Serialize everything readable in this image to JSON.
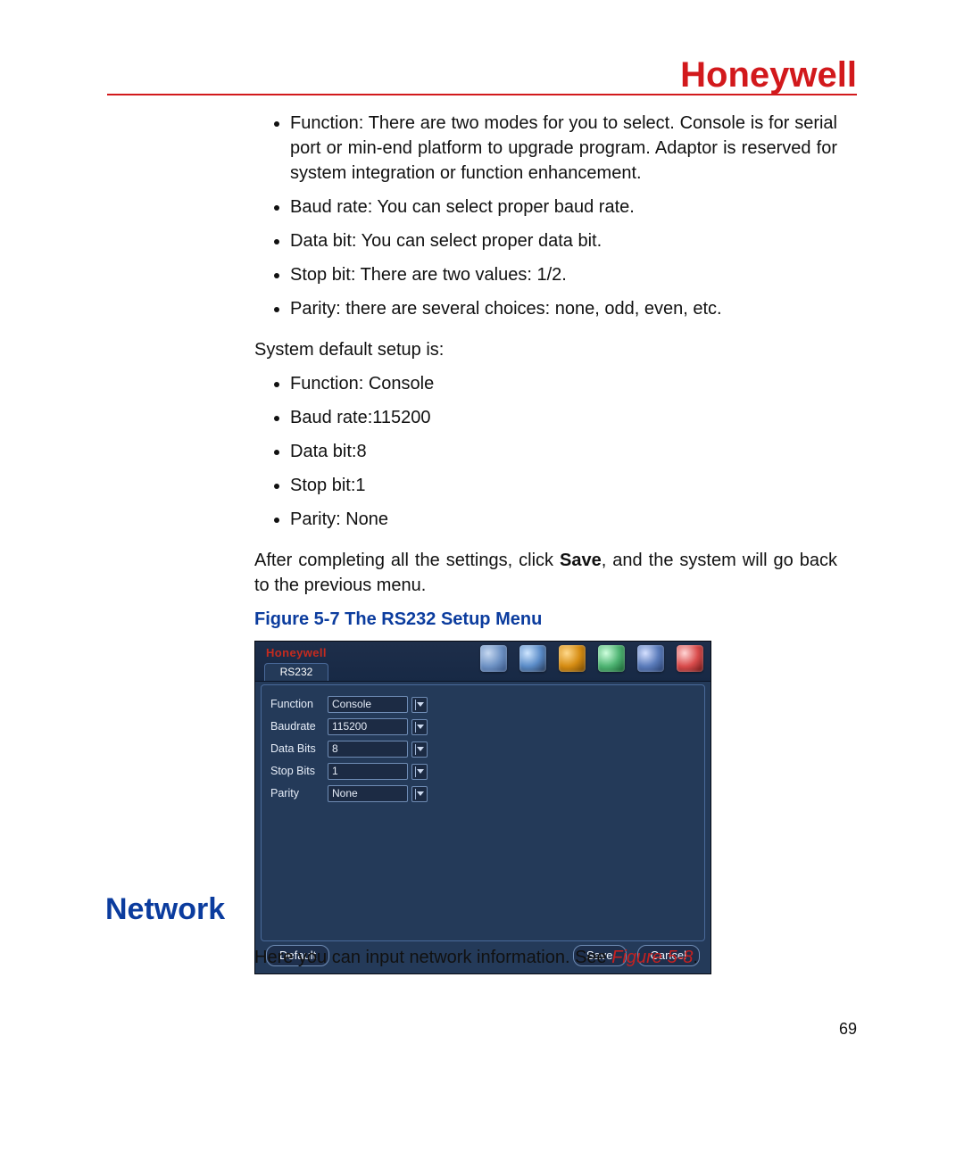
{
  "brand": "Honeywell",
  "bullets1": [
    "Function: There are two modes for you to select. Console is for serial port or min-end platform to upgrade program. Adaptor is reserved for system integration or function enhancement.",
    "Baud rate: You can select proper baud rate.",
    "Data bit: You can select proper data bit.",
    "Stop bit: There are two values: 1/2.",
    "Parity: there are several choices: none, odd, even, etc."
  ],
  "defaults_intro": "System default setup is:",
  "bullets2": [
    "Function: Console",
    "Baud rate:115200",
    "Data bit:8",
    "Stop bit:1",
    "Parity: None"
  ],
  "after_settings_pre": "After completing all the settings, click ",
  "after_settings_bold": "Save",
  "after_settings_post": ", and the system will go back to the previous menu.",
  "figure_caption": "Figure 5-7 The RS232 Setup Menu",
  "dvr": {
    "brand": "Honeywell",
    "tab": "RS232",
    "fields": {
      "function_label": "Function",
      "function_value": "Console",
      "baud_label": "Baudrate",
      "baud_value": "115200",
      "databits_label": "Data Bits",
      "databits_value": "8",
      "stopbits_label": "Stop Bits",
      "stopbits_value": "1",
      "parity_label": "Parity",
      "parity_value": "None"
    },
    "buttons": {
      "default": "Default",
      "save": "Save",
      "cancel": "Cancel"
    }
  },
  "network_heading": "Network",
  "network_body_pre": "Here you can input network information. See ",
  "network_body_ref": "Figure 5-8",
  "network_body_post": ".",
  "page_number": "69"
}
